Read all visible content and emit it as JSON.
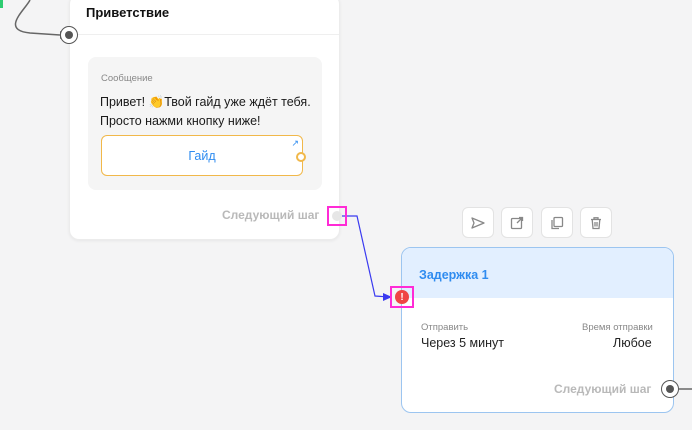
{
  "card_greeting": {
    "title": "Приветствие",
    "message_label": "Сообщение",
    "message_text": "Привет! 👏Твой гайд уже ждёт тебя. Просто нажми кнопку ниже!",
    "button_label": "Гайд",
    "button_ext_icon": "↗",
    "next_step": "Следующий шаг"
  },
  "card_delay": {
    "title": "Задержка 1",
    "send_label": "Отправить",
    "send_value": "Через 5 минут",
    "time_label": "Время отправки",
    "time_value": "Любое",
    "next_step": "Следующий шаг",
    "error_icon": "!"
  },
  "toolbar": {
    "items": [
      "send-icon",
      "open-external-icon",
      "copy-icon",
      "trash-icon"
    ]
  },
  "colors": {
    "accent": "#2f8cf0",
    "button_border": "#f1b84a",
    "highlight": "#ff2bd6",
    "error": "#ef4545",
    "connector": "#3a3af0"
  }
}
